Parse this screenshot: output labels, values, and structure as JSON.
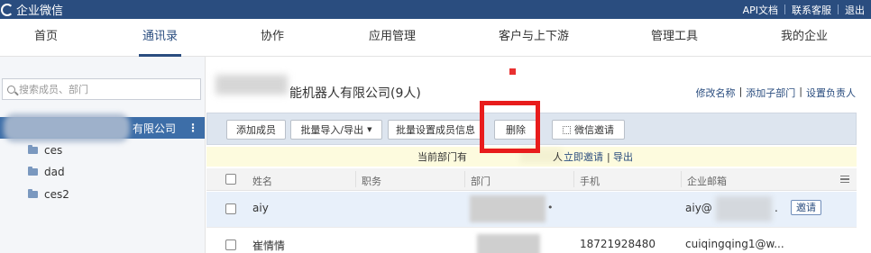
{
  "topbar": {
    "brand": "企业微信",
    "links": [
      "API文档",
      "联系客服",
      "退出"
    ]
  },
  "nav": {
    "items": [
      "首页",
      "通讯录",
      "协作",
      "应用管理",
      "客户与上下游",
      "管理工具",
      "我的企业"
    ],
    "active": "通讯录"
  },
  "sidebar": {
    "search_placeholder": "搜索成员、部门",
    "root_label": "有限公司",
    "root_more": "⋮",
    "departments": [
      "ces",
      "dad",
      "ces2"
    ]
  },
  "main": {
    "company_title": "能机器人有限公司(9人)",
    "title_tools": [
      "修改名称",
      "添加子部门",
      "设置负责人"
    ],
    "toolbar": {
      "add_member": "添加成员",
      "bulk_import_export": "批量导入/导出",
      "bulk_set_info": "批量设置成员信息",
      "delete": "删除",
      "wechat_invite": "微信邀请"
    },
    "notice": {
      "text": "当前部门有",
      "masked_tail": "人",
      "invite_link": "立即邀请",
      "export_link": "导出"
    },
    "columns": [
      "姓名",
      "职务",
      "部门",
      "手机",
      "企业邮箱"
    ],
    "rows": [
      {
        "name": "aiy",
        "title": "",
        "dept": "",
        "phone": "",
        "email": "aiy@",
        "email_tail": ".",
        "action": "邀请"
      },
      {
        "name": "崔情情",
        "title": "",
        "dept": "",
        "phone": "18721928480",
        "email": "cuiqingqing1@w...",
        "email_tail": "",
        "action": ""
      }
    ]
  },
  "colors": {
    "topbar": "#2a4d7f",
    "accent": "#2a4d7f",
    "tree_selected": "#3d6ea8",
    "highlight": "#e81c1c",
    "notice_bg": "#fdfbde"
  }
}
